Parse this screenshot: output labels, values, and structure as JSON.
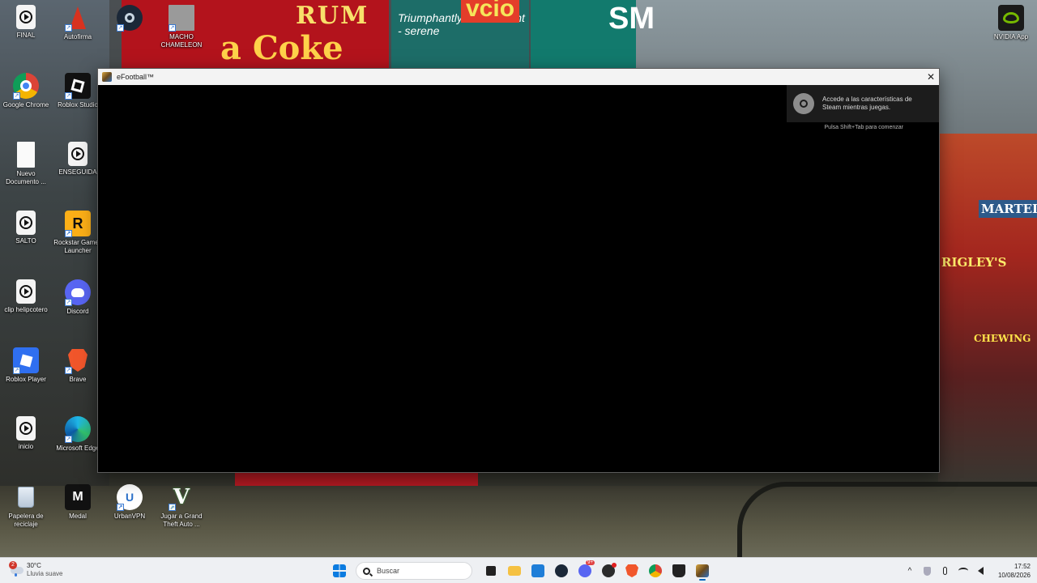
{
  "desktop": {
    "icons": [
      {
        "label": "FINAL"
      },
      {
        "label": "Autofirma"
      },
      {
        "label": ""
      },
      {
        "label": "MACHO CHAMELEON"
      },
      {
        "label": "Google Chrome"
      },
      {
        "label": "Roblox Studio"
      },
      {
        "label": "Nuevo Documento ..."
      },
      {
        "label": "ENSEGUIDA"
      },
      {
        "label": "SALTO"
      },
      {
        "label": "Rockstar Games Launcher"
      },
      {
        "label": "clip helipcotero"
      },
      {
        "label": "Discord"
      },
      {
        "label": "Roblox Player"
      },
      {
        "label": "Brave"
      },
      {
        "label": "inicio"
      },
      {
        "label": "Microsoft Edge"
      },
      {
        "label": "Papelera de reciclaje"
      },
      {
        "label": "Medal"
      },
      {
        "label": "UrbanVPN"
      },
      {
        "label": "Jugar a Grand Theft Auto ..."
      },
      {
        "label": "NVIDIA App"
      }
    ]
  },
  "wallpaper": {
    "rum": "RUM",
    "coke": "a Coke",
    "vcio": "vcio",
    "triumph": "Triumphantly swift - silent - serene",
    "sm": "SM",
    "martell": "MARTELL",
    "wrigleys": "RIGLEY'S",
    "chewing": "CHEWING"
  },
  "window": {
    "title": "eFootball™",
    "close_glyph": "✕"
  },
  "steam": {
    "message": "Accede a las características de Steam mientras juegas.",
    "hint": "Pulsa Shift+Tab para comenzar"
  },
  "taskbar": {
    "weather_badge": "2",
    "temperature": "30°C",
    "condition": "Lluvia suave",
    "search_placeholder": "Buscar",
    "discord_badge": "9+",
    "tray_chevron": "^",
    "time": "17:52",
    "date": "10/08/2026"
  },
  "colors": {
    "steam_toast": "#1c1c1c",
    "taskbar": "#eef0f3",
    "accent": "#0067c0"
  }
}
